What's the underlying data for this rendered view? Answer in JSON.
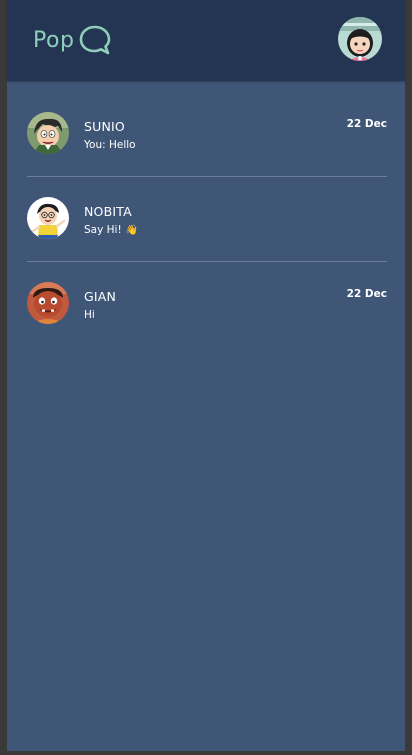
{
  "app": {
    "logo_text": "Pop"
  },
  "colors": {
    "background": "#3f5677",
    "header": "#243553",
    "logo": "#8fcfba",
    "divider": "#6b7f9a"
  },
  "chats": [
    {
      "name": "SUNIO",
      "message": "You: Hello",
      "date": "22 Dec",
      "avatar_icon": "sunio-avatar"
    },
    {
      "name": "NOBITA",
      "message": "Say Hi!",
      "emoji": "👋",
      "date": "",
      "avatar_icon": "nobita-avatar"
    },
    {
      "name": "GIAN",
      "message": "Hi",
      "date": "22 Dec",
      "avatar_icon": "gian-avatar"
    }
  ]
}
